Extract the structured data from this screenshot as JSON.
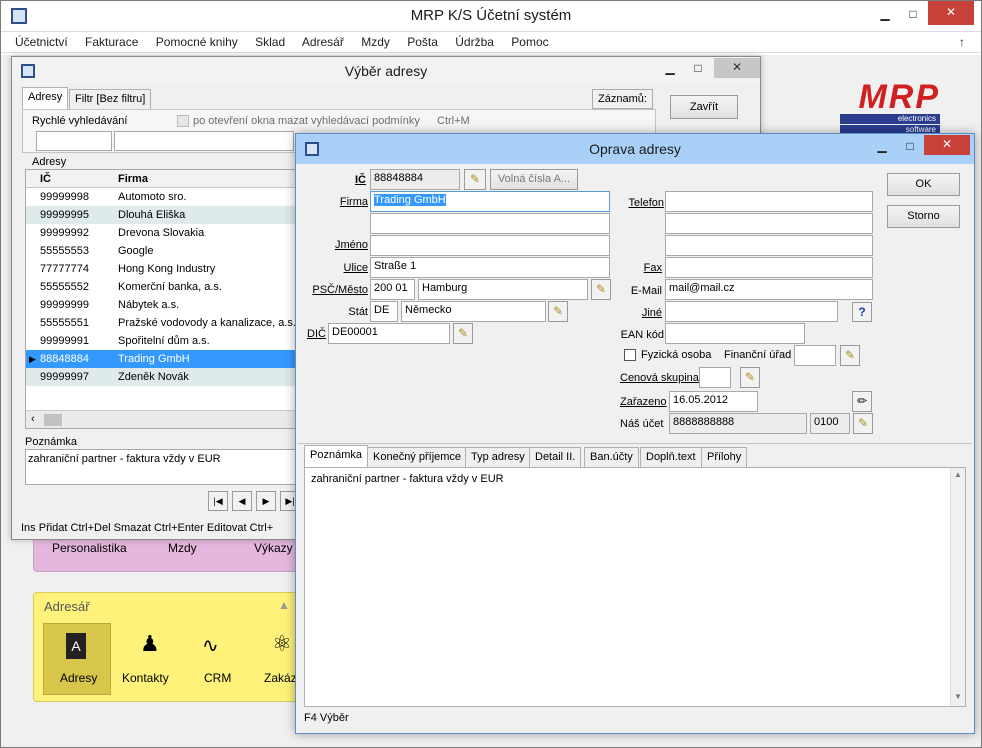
{
  "app": {
    "title": "MRP K/S Účetní systém",
    "menu": [
      "Účetnictví",
      "Fakturace",
      "Pomocné knihy",
      "Sklad",
      "Adresář",
      "Mzdy",
      "Pošta",
      "Údržba",
      "Pomoc"
    ],
    "logo": {
      "text": "MRP",
      "sub1": "electronics",
      "sub2": "software"
    }
  },
  "background": {
    "pink_panel": {
      "items": [
        "Personalistika",
        "Mzdy",
        "Výkazy"
      ]
    },
    "adresar_panel": {
      "title": "Adresář",
      "items": [
        "Adresy",
        "Kontakty",
        "CRM",
        "Zakázk"
      ]
    }
  },
  "vyber": {
    "title": "Výběr adresy",
    "tabs": [
      "Adresy",
      "Filtr [Bez filtru]"
    ],
    "zaznamu_label": "Záznamů:",
    "zavrit_label": "Zavřít",
    "quick_search_label": "Rychlé vyhledávání",
    "clear_checkbox_label": "po otevření okna mazat vyhledávací podmínky",
    "clear_shortcut": "Ctrl+M",
    "grid_label": "Adresy",
    "columns": [
      "IČ",
      "Firma"
    ],
    "rows": [
      {
        "ic": "99999998",
        "firma": "Automoto sro."
      },
      {
        "ic": "99999995",
        "firma": "Dlouhá Eliška"
      },
      {
        "ic": "99999992",
        "firma": "Drevona Slovakia"
      },
      {
        "ic": "55555553",
        "firma": "Google"
      },
      {
        "ic": "77777774",
        "firma": "Hong Kong  Industry"
      },
      {
        "ic": "55555552",
        "firma": "Komerční banka, a.s."
      },
      {
        "ic": "99999999",
        "firma": "Nábytek a.s."
      },
      {
        "ic": "55555551",
        "firma": "Pražské vodovody a kanalizace, a.s."
      },
      {
        "ic": "99999991",
        "firma": "Spořitelní dům a.s."
      },
      {
        "ic": "88848884",
        "firma": "Trading GmbH"
      },
      {
        "ic": "99999997",
        "firma": "Zdeněk Novák"
      }
    ],
    "note_label": "Poznámka",
    "note_text": "zahraniční partner - faktura vždy v EUR",
    "status": "Ins Přidat  Ctrl+Del Smazat  Ctrl+Enter Editovat  Ctrl+"
  },
  "oprava": {
    "title": "Oprava adresy",
    "ok_label": "OK",
    "storno_label": "Storno",
    "ic_label": "IČ",
    "ic_value": "88848884",
    "volna_label": "Volná čísla A...",
    "firma_label": "Firma",
    "firma_value": "Trading GmbH",
    "firma2_value": "",
    "jmeno_label": "Jméno",
    "jmeno_value": "",
    "ulice_label": "Ulice",
    "ulice_value": "Straße 1",
    "psc_label": "PSČ/Město",
    "psc_value": "200 01",
    "mesto_value": "Hamburg",
    "stat_label": "Stát",
    "stat_code": "DE",
    "stat_name": "Německo",
    "dic_label": "DIČ",
    "dic_value": "DE00001",
    "telefon_label": "Telefon",
    "telefon_value": "",
    "fax_label": "Fax",
    "fax_value": "",
    "email_label": "E-Mail",
    "email_value": "mail@mail.cz",
    "jine_label": "Jiné",
    "jine_value": "",
    "ean_label": "EAN kód",
    "ean_value": "",
    "fyzicka_label": "Fyzická osoba",
    "fyzicka_checked": false,
    "financni_label": "Finanční úřad",
    "financni_value": "",
    "cenova_label": "Cenová skupina",
    "cenova_value": "",
    "zarazeno_label": "Zařazeno",
    "zarazeno_value": "16.05.2012",
    "nas_ucet_label": "Náš účet",
    "nas_ucet_value": "8888888888",
    "nas_ucet_code": "0100",
    "tabs": [
      "Poznámka",
      "Konečný příjemce",
      "Typ adresy",
      "Detail II.",
      "Ban.účty",
      "Doplň.text",
      "Přílohy"
    ],
    "note_text": "zahraniční partner - faktura vždy v EUR",
    "status": "F4 Výběr"
  },
  "colors": {
    "selection": "#3399ff",
    "title_active": "#a9d1f7",
    "alt_row": "#dfeaea",
    "pink": "#e6b7de",
    "yellow": "#fff27a"
  }
}
